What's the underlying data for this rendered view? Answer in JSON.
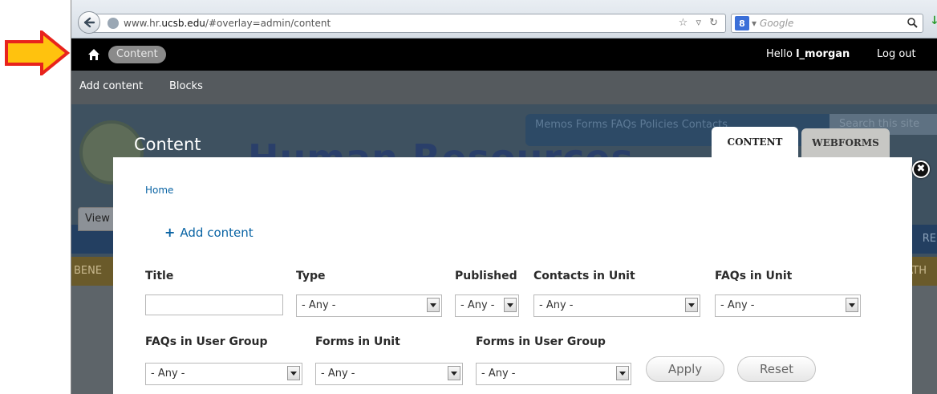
{
  "browser": {
    "url_prefix": "www.hr.",
    "url_domain": "ucsb.edu",
    "url_path": "/#overlay=admin/content",
    "search_engine_badge": "8",
    "search_placeholder": "Google"
  },
  "toolbar": {
    "active_item": "Content",
    "greeting_prefix": "Hello ",
    "username": "l_morgan",
    "logout": "Log out"
  },
  "shortcuts": [
    "Add content",
    "Blocks"
  ],
  "site_background": {
    "nav_links": "Memos  Forms  FAQs  Policies  Contacts",
    "search_placeholder": "Search this site",
    "title_fragment": "Human Resources",
    "band_fragment_left": "BENE",
    "band_fragment_right": "ATH",
    "band_fragment_blue": "RE",
    "view_tab": "View"
  },
  "overlay": {
    "title": "Content",
    "tabs": [
      "CONTENT",
      "WEBFORMS"
    ],
    "close_symbol": "✖",
    "breadcrumb": "Home",
    "add_content_icon": "+",
    "add_content": "Add content"
  },
  "filters": {
    "title_label": "Title",
    "title_value": "",
    "type_label": "Type",
    "type_value": "- Any -",
    "published_label": "Published",
    "published_value": "- Any -",
    "contacts_label": "Contacts in Unit",
    "contacts_value": "- Any -",
    "faqs_unit_label": "FAQs in Unit",
    "faqs_unit_value": "- Any -",
    "faqs_group_label": "FAQs in User Group",
    "faqs_group_value": "- Any -",
    "forms_unit_label": "Forms in Unit",
    "forms_unit_value": "- Any -",
    "forms_group_label": "Forms in User Group",
    "forms_group_value": "- Any -",
    "apply": "Apply",
    "reset": "Reset"
  },
  "icons": {
    "callout": "arrow-right-icon",
    "home": "home-icon",
    "back": "back-arrow-icon",
    "close": "close-icon",
    "search": "magnifier-icon"
  },
  "colors": {
    "arrow_fill": "#ffc20e",
    "arrow_outline": "#e8231c",
    "toolbar": "#000000",
    "link": "#0a64a4"
  }
}
